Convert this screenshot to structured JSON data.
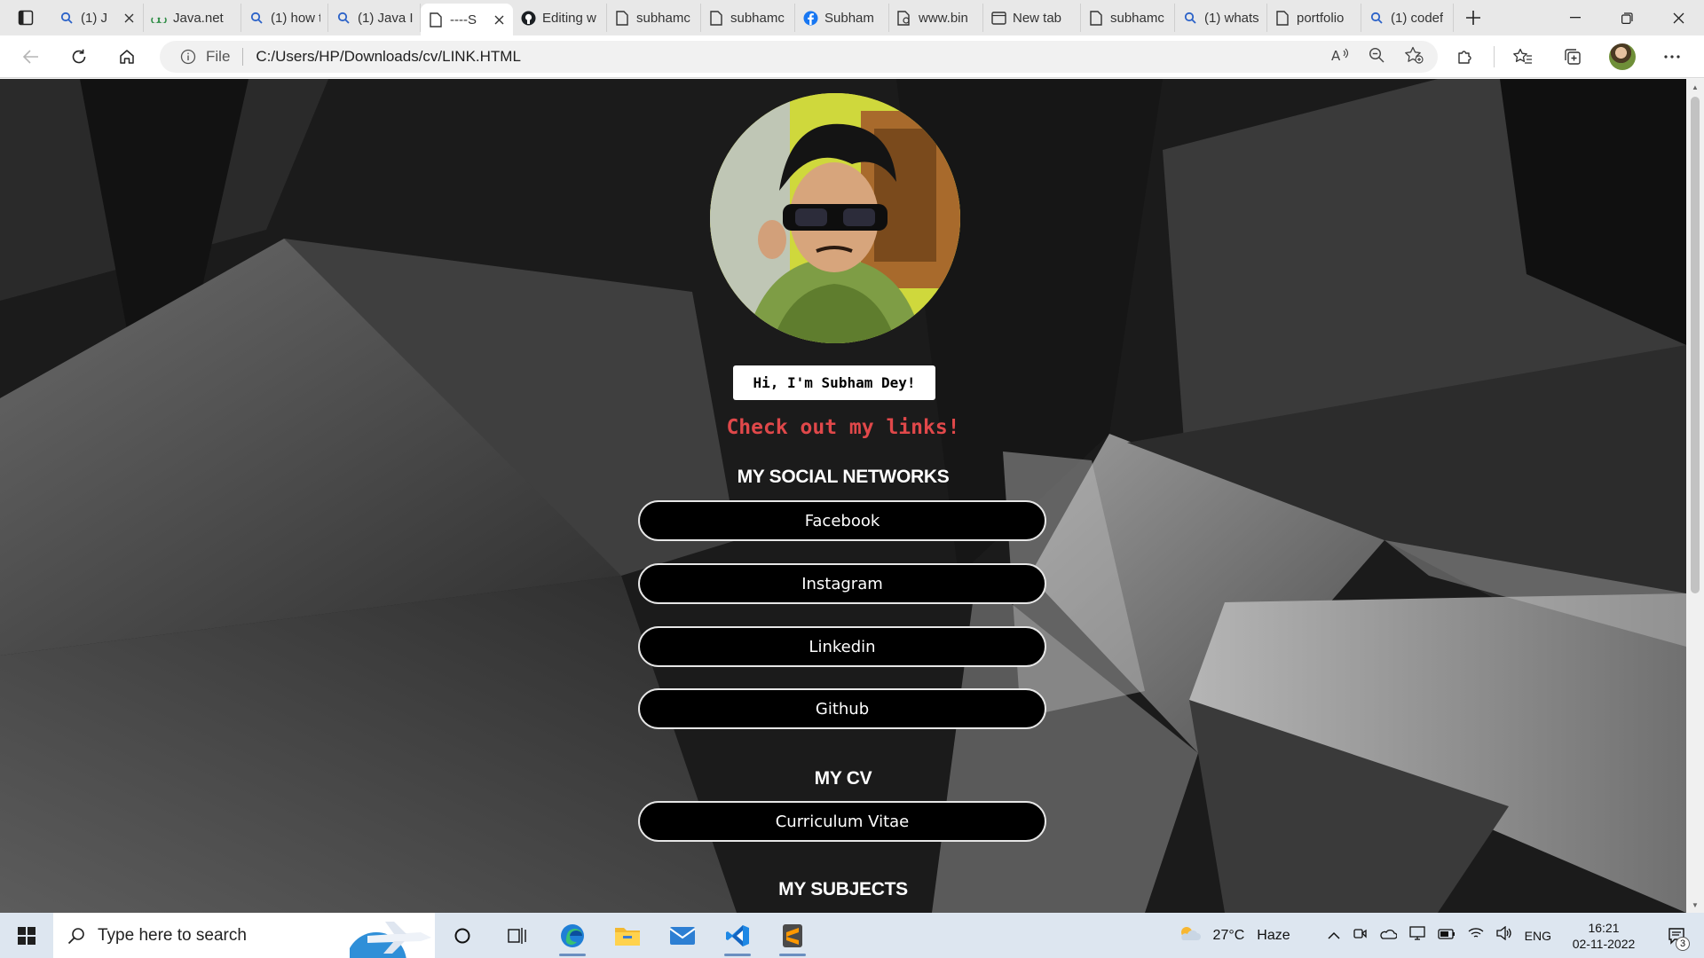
{
  "browser": {
    "tabs": [
      {
        "title": "(1) J",
        "icon": "search-icon"
      },
      {
        "title": "Java.net",
        "icon": "geeks-icon"
      },
      {
        "title": "(1) how t",
        "icon": "search-icon"
      },
      {
        "title": "(1) Java I",
        "icon": "search-icon"
      },
      {
        "title": "----S",
        "icon": "page-icon",
        "active": true
      },
      {
        "title": "Editing w",
        "icon": "github-icon"
      },
      {
        "title": "subhamc",
        "icon": "page-icon"
      },
      {
        "title": "subhamc",
        "icon": "page-icon"
      },
      {
        "title": "Subham",
        "icon": "facebook-icon"
      },
      {
        "title": "www.bin",
        "icon": "page-icon"
      },
      {
        "title": "New tab",
        "icon": "newtab-icon"
      },
      {
        "title": "subhamc",
        "icon": "page-icon"
      },
      {
        "title": "(1) whats",
        "icon": "search-icon"
      },
      {
        "title": "portfolio",
        "icon": "page-icon"
      },
      {
        "title": "(1) codef",
        "icon": "search-icon"
      }
    ],
    "address": {
      "scheme_label": "File",
      "url": "C:/Users/HP/Downloads/cv/LINK.HTML"
    }
  },
  "page": {
    "greeting": "Hi, I'm Subham Dey!",
    "tagline": "Check out my links!",
    "sections": [
      {
        "heading": "MY SOCIAL NETWORKS",
        "links": [
          "Facebook",
          "Instagram",
          "Linkedin",
          "Github"
        ]
      },
      {
        "heading": "MY CV",
        "links": [
          "Curriculum Vitae"
        ]
      },
      {
        "heading": "MY SUBJECTS",
        "links": []
      }
    ],
    "colors": {
      "tagline": "#e0484a",
      "button_bg": "#000000",
      "button_border": "#e6e6e6"
    }
  },
  "taskbar": {
    "search_placeholder": "Type here to search",
    "weather": {
      "temp": "27°C",
      "condition": "Haze"
    },
    "language": "ENG",
    "time": "16:21",
    "date": "02-11-2022",
    "notification_count": "3"
  }
}
